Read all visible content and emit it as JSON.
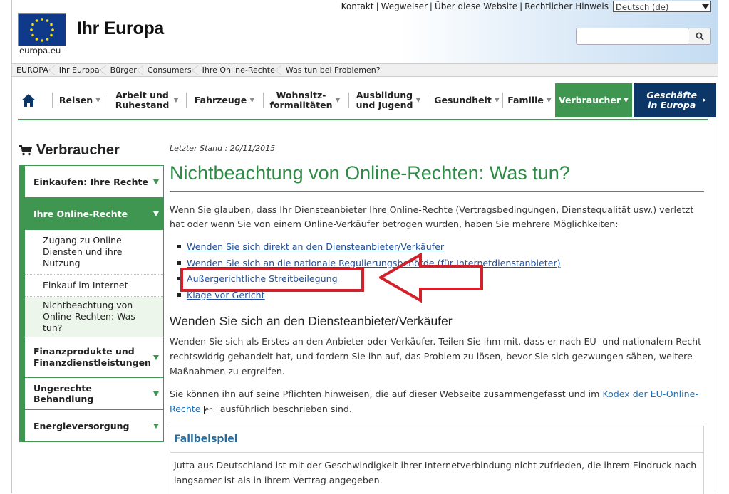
{
  "header": {
    "top_links": [
      "Kontakt",
      "Wegweiser",
      "Über diese Website",
      "Rechtlicher Hinweis"
    ],
    "language": "Deutsch (de)",
    "logo_caption": "europa.eu",
    "site_title": "Ihr Europa",
    "search_placeholder": ""
  },
  "breadcrumb": [
    "EUROPA",
    "Ihr Europa",
    "Bürger",
    "Consumers",
    "Ihre Online-Rechte",
    "Was tun bei Problemen?"
  ],
  "nav": {
    "items": [
      {
        "label": "Reisen"
      },
      {
        "label": "Arbeit und Ruhestand"
      },
      {
        "label": "Fahrzeuge"
      },
      {
        "label": "Wohnsitz-formalitäten"
      },
      {
        "label": "Ausbildung und Jugend"
      },
      {
        "label": "Gesundheit"
      },
      {
        "label": "Familie"
      },
      {
        "label": "Verbraucher"
      },
      {
        "label": "Geschäfte in Europa"
      }
    ]
  },
  "sidebar": {
    "title": "Verbraucher",
    "items": [
      {
        "label": "Einkaufen: Ihre Rechte"
      },
      {
        "label": "Ihre Online-Rechte"
      },
      {
        "label": "Finanzprodukte und Finanzdienstleistungen"
      },
      {
        "label": "Ungerechte Behandlung"
      },
      {
        "label": "Energieversorgung"
      }
    ],
    "subitems": [
      {
        "label": "Zugang zu Online-Diensten und ihre Nutzung"
      },
      {
        "label": "Einkauf im Internet"
      },
      {
        "label": "Nichtbeachtung von Online-Rechten: Was tun?"
      }
    ]
  },
  "main": {
    "last_updated": "Letzter Stand : 20/11/2015",
    "title": "Nichtbeachtung von Online-Rechten: Was tun?",
    "intro": "Wenn Sie glauben, dass Ihr Diensteanbieter Ihre Online-Rechte (Vertragsbedingungen, Dienstequalität usw.) verletzt hat oder wenn Sie von einem Online-Verkäufer betrogen wurden, haben Sie mehrere Möglichkeiten:",
    "links": [
      "Wenden Sie sich direkt an den Diensteanbieter/Verkäufer",
      "Wenden Sie sich an die nationale Regulierungsbehörde (für Internetdienstanbieter)",
      "Außergerichtliche Streitbeilegung",
      "Klage vor Gericht"
    ],
    "section_title": "Wenden Sie sich an den Diensteanbieter/Verkäufer",
    "paragraph1": "Wenden Sie sich als Erstes an den Anbieter oder Verkäufer. Teilen Sie ihm mit, dass er nach EU- und nationalem Recht rechtswidrig gehandelt hat, und fordern Sie ihn auf, das Problem zu lösen, bevor Sie sich gezwungen sähen, weitere Maßnahmen zu ergreifen.",
    "paragraph2_before": "Sie können ihn auf seine Pflichten hinweisen, die auf dieser Webseite zusammengefasst und im ",
    "paragraph2_link": "Kodex der EU-Online-Rechte",
    "paragraph2_badge": "en",
    "paragraph2_after": " ausführlich beschrieben sind.",
    "case_title": "Fallbeispiel",
    "case_text": "Jutta aus Deutschland ist mit der Geschwindigkeit ihrer Internetverbindung nicht zufrieden, die ihrem Eindruck nach langsamer ist als in ihrem Vertrag angegeben."
  },
  "colors": {
    "green": "#3e9650",
    "navy": "#0d3668",
    "link": "#1f4fa0",
    "annotation_red": "#d3212b"
  }
}
